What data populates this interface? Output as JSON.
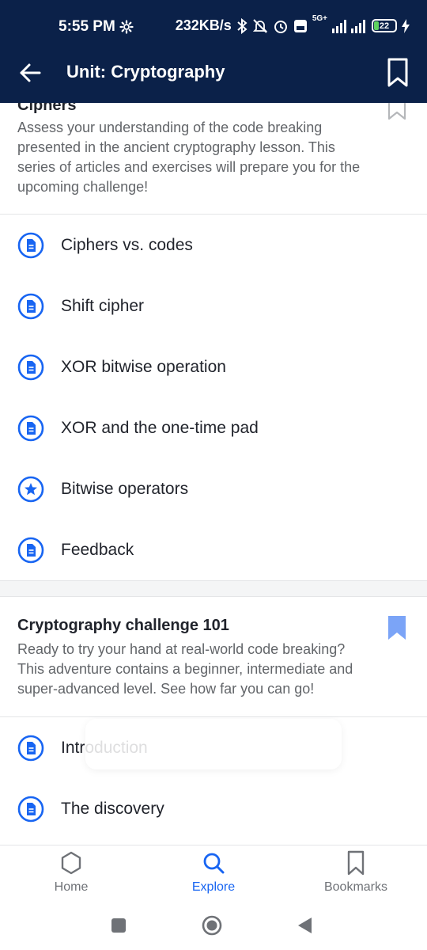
{
  "status_bar": {
    "time": "5:55 PM",
    "network_speed": "232KB/s",
    "network_type": "5G+",
    "battery": "22",
    "icons": [
      "settings-gear-icon",
      "bluetooth-icon",
      "mute-icon",
      "alarm-icon",
      "volte-icon",
      "signal-icon",
      "charging-icon"
    ]
  },
  "app_bar": {
    "title": "Unit: Cryptography",
    "back_icon": "arrow-left-icon",
    "bookmark_icon": "bookmark-outline-icon"
  },
  "sections": [
    {
      "title": "Ciphers",
      "description": "Assess your understanding of the code breaking presented in the ancient cryptography lesson. This series of articles and exercises will prepare you for the upcoming challenge!",
      "bookmarked": false,
      "items": [
        {
          "label": "Ciphers vs. codes",
          "icon": "article-icon"
        },
        {
          "label": "Shift cipher",
          "icon": "article-icon"
        },
        {
          "label": "XOR bitwise operation",
          "icon": "article-icon"
        },
        {
          "label": "XOR and the one-time pad",
          "icon": "article-icon"
        },
        {
          "label": "Bitwise operators",
          "icon": "star-icon"
        },
        {
          "label": "Feedback",
          "icon": "article-icon"
        }
      ]
    },
    {
      "title": "Cryptography challenge 101",
      "description": "Ready to try your hand at real-world code breaking? This adventure contains a beginner, intermediate and super-advanced level. See how far you can go!",
      "bookmarked": true,
      "items": [
        {
          "label": "Introduction",
          "icon": "article-icon"
        },
        {
          "label": "The discovery",
          "icon": "article-icon"
        }
      ]
    }
  ],
  "bottom_nav": [
    {
      "label": "Home",
      "icon": "hexagon-icon",
      "active": false
    },
    {
      "label": "Explore",
      "icon": "search-icon",
      "active": true
    },
    {
      "label": "Bookmarks",
      "icon": "bookmark-icon",
      "active": false
    }
  ],
  "colors": {
    "header_bg": "#0b2149",
    "accent": "#1865f2",
    "bookmark_filled": "#7ba4f7",
    "text": "#21242c",
    "muted": "#626569"
  }
}
